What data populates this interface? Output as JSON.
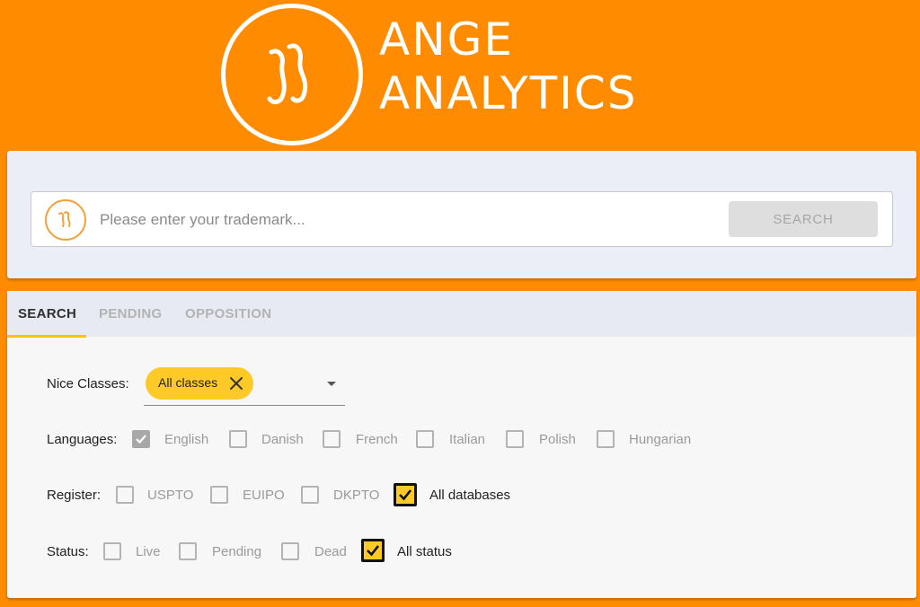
{
  "brand": {
    "line1": "ANGE",
    "line2": "ANALYTICS",
    "logo_icon": "ange-squiggle-icon",
    "accent": "#ff8c00",
    "highlight": "#ffc928"
  },
  "search": {
    "placeholder": "Please enter your trademark...",
    "value": "",
    "button_label": "SEARCH"
  },
  "tabs": [
    {
      "label": "SEARCH",
      "active": true
    },
    {
      "label": "PENDING",
      "active": false
    },
    {
      "label": "OPPOSITION",
      "active": false
    }
  ],
  "filters": {
    "nice_classes": {
      "label": "Nice Classes:",
      "chip": "All classes"
    },
    "languages": {
      "label": "Languages:",
      "options": [
        {
          "label": "English",
          "checked": true,
          "disabled": true
        },
        {
          "label": "Danish",
          "checked": false
        },
        {
          "label": "French",
          "checked": false
        },
        {
          "label": "Italian",
          "checked": false
        },
        {
          "label": "Polish",
          "checked": false
        },
        {
          "label": "Hungarian",
          "checked": false
        }
      ]
    },
    "register": {
      "label": "Register:",
      "options": [
        {
          "label": "USPTO",
          "checked": false
        },
        {
          "label": "EUIPO",
          "checked": false
        },
        {
          "label": "DKPTO",
          "checked": false
        },
        {
          "label": "All databases",
          "checked": true
        }
      ]
    },
    "status": {
      "label": "Status:",
      "options": [
        {
          "label": "Live",
          "checked": false
        },
        {
          "label": "Pending",
          "checked": false
        },
        {
          "label": "Dead",
          "checked": false
        },
        {
          "label": "All status",
          "checked": true
        }
      ]
    }
  }
}
